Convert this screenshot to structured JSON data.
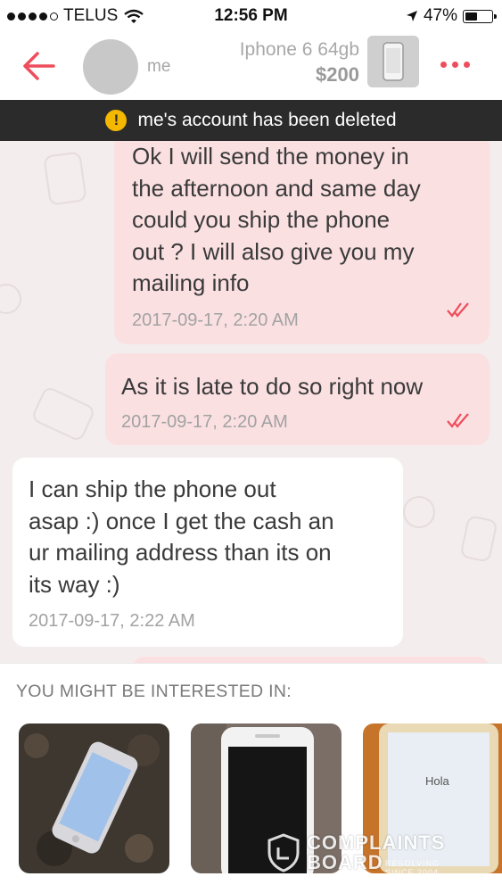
{
  "status_bar": {
    "carrier": "TELUS",
    "time": "12:56 PM",
    "battery_percent": "47%",
    "battery_level": 0.47,
    "icons": [
      "signal-dots-icon",
      "wifi-icon",
      "location-arrow-icon",
      "battery-icon"
    ]
  },
  "header": {
    "back_icon": "arrow-left-icon",
    "user_name": "me",
    "listing_title": "Iphone 6 64gb",
    "listing_price": "$200",
    "more_icon": "more-dots-icon"
  },
  "banner": {
    "icon": "warning-icon",
    "icon_glyph": "!",
    "text": "me's account has been deleted"
  },
  "messages": [
    {
      "direction": "outgoing",
      "text": "Ok I will send the money in\nthe afternoon and same day\ncould you ship the phone\nout ? I will also give you my\nmailing info",
      "timestamp": "2017-09-17, 2:20 AM",
      "status_icon": "double-check-icon"
    },
    {
      "direction": "outgoing",
      "text": "As it is late to do so right now",
      "timestamp": "2017-09-17, 2:20 AM",
      "status_icon": "double-check-icon"
    },
    {
      "direction": "incoming",
      "text": "I can ship the phone out\nasap :) once I get the cash an\nur mailing address than its on\nits way :)",
      "timestamp": "2017-09-17, 2:22 AM"
    }
  ],
  "recommendations": {
    "title": "YOU MIGHT BE INTERESTED IN:",
    "items": [
      {
        "image": "iphone-on-granite-photo"
      },
      {
        "image": "iphone-front-black-screen-photo"
      },
      {
        "image": "iphone-hola-screen-photo",
        "screen_text": "Hola"
      }
    ]
  },
  "watermark": {
    "text": "COMPLAINTS BOARD",
    "subtext": "RESOLVING SINCE 2004"
  },
  "colors": {
    "accent": "#ee4d5b",
    "outgoing_bubble": "#fbe0e2",
    "incoming_bubble": "#ffffff",
    "banner_bg": "#2b2b2b",
    "warning": "#f5b800"
  }
}
